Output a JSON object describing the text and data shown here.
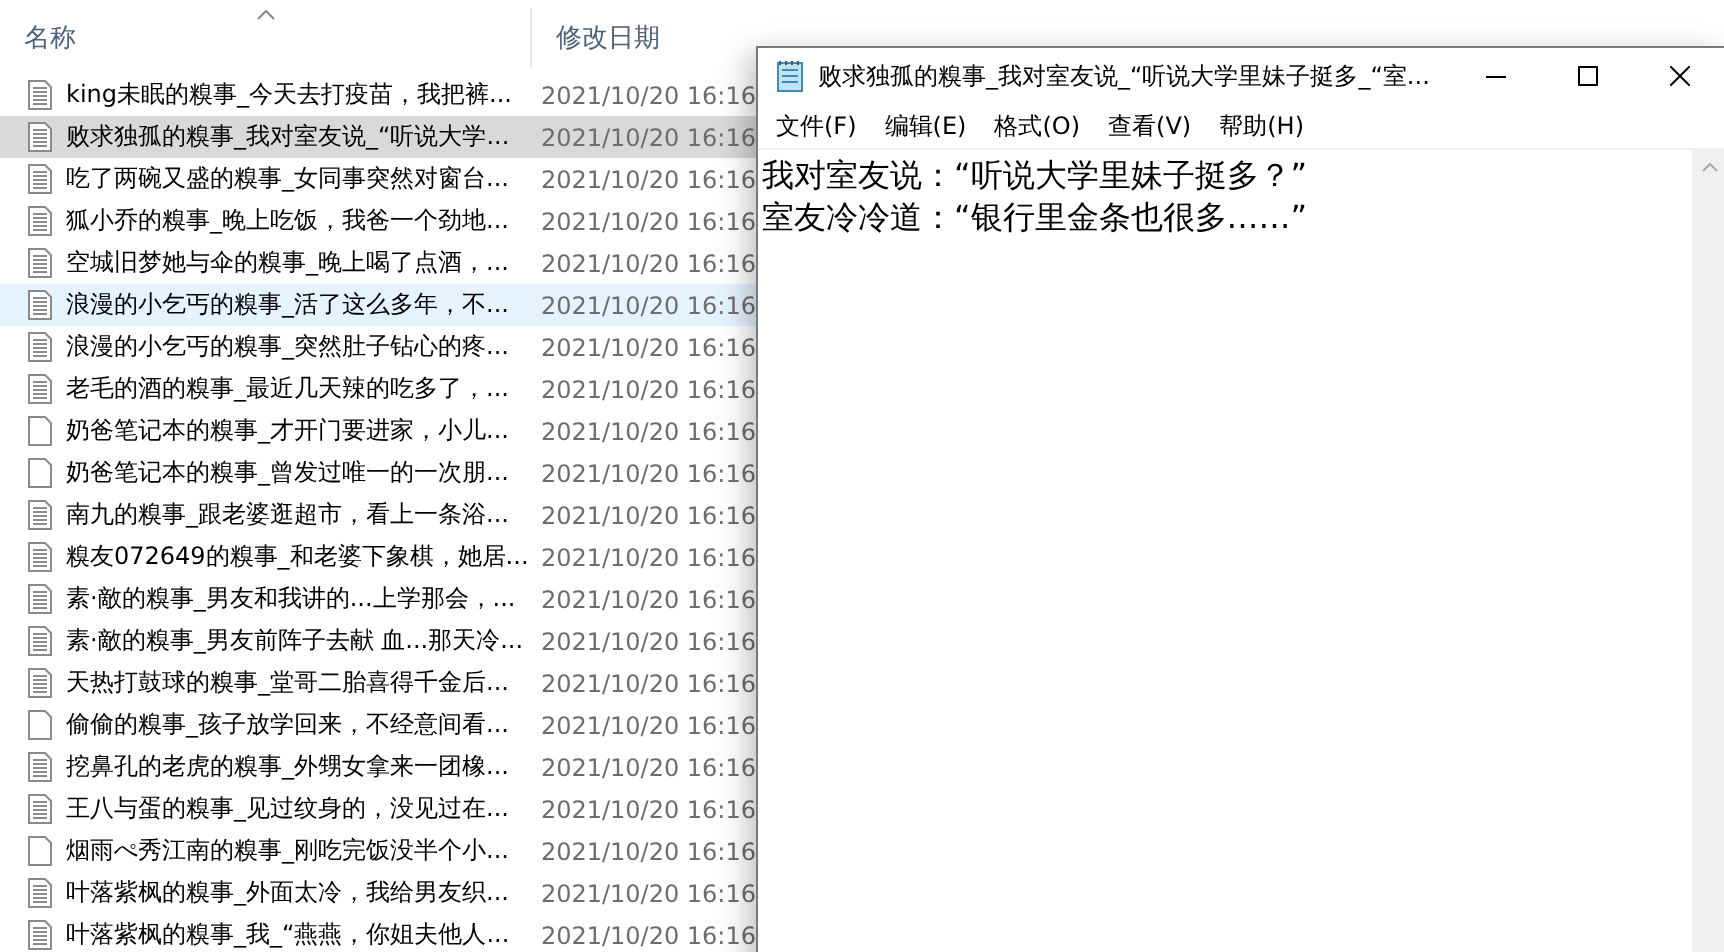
{
  "explorer": {
    "columns": [
      {
        "label": "名称",
        "sorted": true
      },
      {
        "label": "修改日期",
        "sorted": false
      }
    ],
    "files": [
      {
        "name": "king未眠的糗事_今天去打疫苗，我把裤...",
        "modified": "2021/10/20 16:16",
        "kind": "text",
        "selected": false,
        "hovered": false
      },
      {
        "name": "败求独孤的糗事_我对室友说_“听说大学...",
        "modified": "2021/10/20 16:16",
        "kind": "text",
        "selected": true,
        "hovered": false
      },
      {
        "name": "吃了两碗又盛的糗事_女同事突然对窗台...",
        "modified": "2021/10/20 16:16",
        "kind": "text",
        "selected": false,
        "hovered": false
      },
      {
        "name": "狐小乔的糗事_晚上吃饭，我爸一个劲地...",
        "modified": "2021/10/20 16:16",
        "kind": "text",
        "selected": false,
        "hovered": false
      },
      {
        "name": "空城旧梦她与伞的糗事_晚上喝了点酒，...",
        "modified": "2021/10/20 16:16",
        "kind": "text",
        "selected": false,
        "hovered": false
      },
      {
        "name": "浪漫的小乞丐的糗事_活了这么多年，不...",
        "modified": "2021/10/20 16:16",
        "kind": "text",
        "selected": false,
        "hovered": true
      },
      {
        "name": "浪漫的小乞丐的糗事_突然肚子钻心的疼...",
        "modified": "2021/10/20 16:16",
        "kind": "text",
        "selected": false,
        "hovered": false
      },
      {
        "name": "老毛的酒的糗事_最近几天辣的吃多了，...",
        "modified": "2021/10/20 16:16",
        "kind": "text",
        "selected": false,
        "hovered": false
      },
      {
        "name": "奶爸笔记本的糗事_才开门要进家，小儿...",
        "modified": "2021/10/20 16:16",
        "kind": "blank",
        "selected": false,
        "hovered": false
      },
      {
        "name": "奶爸笔记本的糗事_曾发过唯一的一次朋...",
        "modified": "2021/10/20 16:16",
        "kind": "blank",
        "selected": false,
        "hovered": false
      },
      {
        "name": "南九的糗事_跟老婆逛超市，看上一条浴...",
        "modified": "2021/10/20 16:16",
        "kind": "text",
        "selected": false,
        "hovered": false
      },
      {
        "name": "糗友072649的糗事_和老婆下象棋，她居...",
        "modified": "2021/10/20 16:16",
        "kind": "text",
        "selected": false,
        "hovered": false
      },
      {
        "name": "素·敵的糗事_男友和我讲的...上学那会，...",
        "modified": "2021/10/20 16:16",
        "kind": "text",
        "selected": false,
        "hovered": false
      },
      {
        "name": "素·敵的糗事_男友前阵子去献 血...那天冷...",
        "modified": "2021/10/20 16:16",
        "kind": "text",
        "selected": false,
        "hovered": false
      },
      {
        "name": "天热打鼓球的糗事_堂哥二胎喜得千金后...",
        "modified": "2021/10/20 16:16",
        "kind": "text",
        "selected": false,
        "hovered": false
      },
      {
        "name": "偷偷的糗事_孩子放学回来，不经意间看...",
        "modified": "2021/10/20 16:16",
        "kind": "blank",
        "selected": false,
        "hovered": false
      },
      {
        "name": "挖鼻孔的老虎的糗事_外甥女拿来一团橡...",
        "modified": "2021/10/20 16:16",
        "kind": "text",
        "selected": false,
        "hovered": false
      },
      {
        "name": "王八与蛋的糗事_见过纹身的，没见过在...",
        "modified": "2021/10/20 16:16",
        "kind": "text",
        "selected": false,
        "hovered": false
      },
      {
        "name": "烟雨ぺ秀江南的糗事_刚吃完饭没半个小...",
        "modified": "2021/10/20 16:16",
        "kind": "blank",
        "selected": false,
        "hovered": false
      },
      {
        "name": "叶落紫枫的糗事_外面太冷，我给男友织...",
        "modified": "2021/10/20 16:16",
        "kind": "text",
        "selected": false,
        "hovered": false
      },
      {
        "name": "叶落紫枫的糗事_我_“燕燕，你姐夫他人...",
        "modified": "2021/10/20 16:16",
        "kind": "text",
        "selected": false,
        "hovered": false
      }
    ]
  },
  "notepad": {
    "title": "败求独孤的糗事_我对室友说_“听说大学里妹子挺多_“室...",
    "menu": [
      "文件(F)",
      "编辑(E)",
      "格式(O)",
      "查看(V)",
      "帮助(H)"
    ],
    "lines": [
      "我对室友说：“听说大学里妹子挺多？”",
      "室友冷冷道：“银行里金条也很多……”"
    ]
  }
}
